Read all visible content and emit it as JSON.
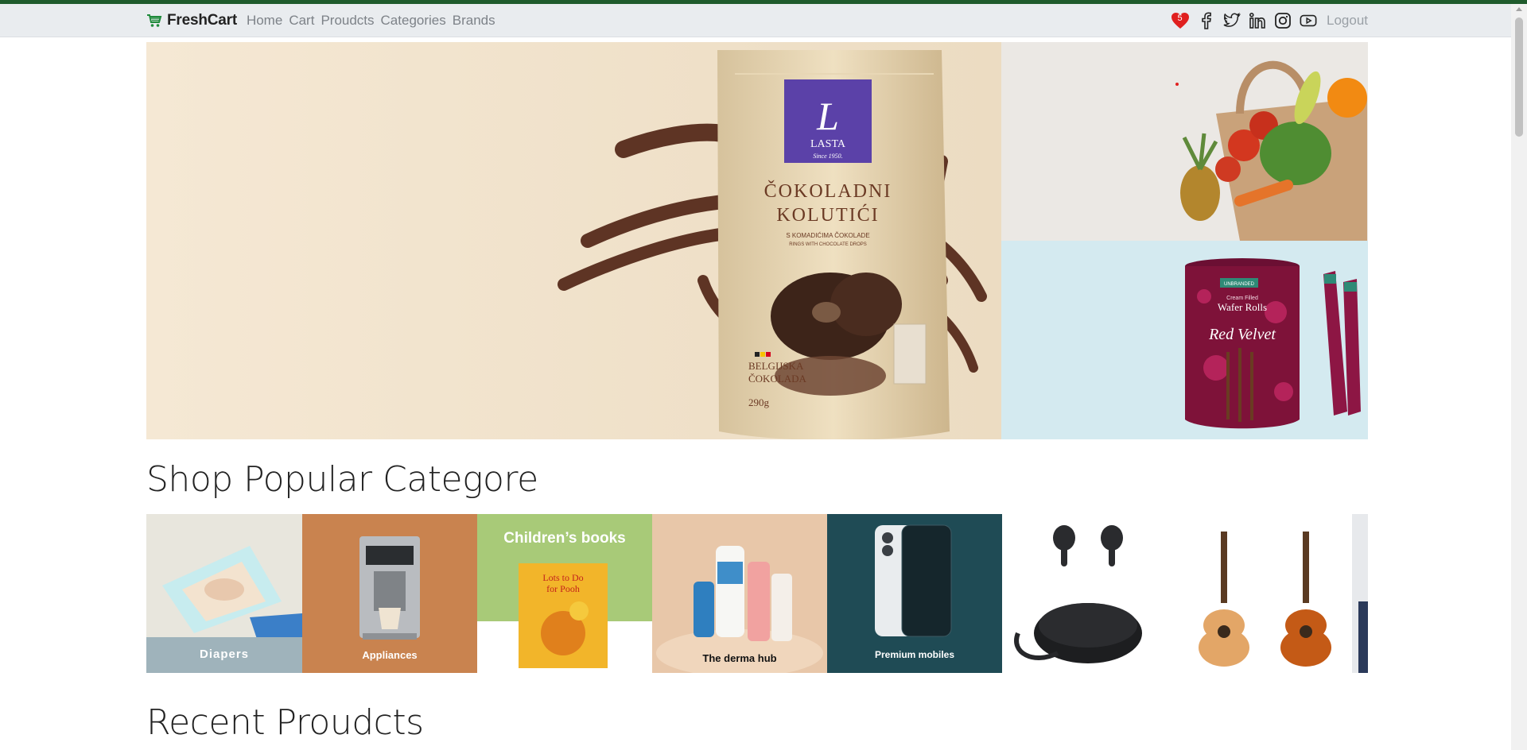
{
  "brand": {
    "name": "FreshCart",
    "icon": "cart-icon"
  },
  "nav": {
    "links": [
      "Home",
      "Cart",
      "Proudcts",
      "Categories",
      "Brands"
    ],
    "wishlist_count": "5",
    "social": [
      "facebook-icon",
      "twitter-icon",
      "linkedin-icon",
      "instagram-icon",
      "youtube-icon"
    ],
    "logout": "Logout"
  },
  "hero": {
    "main": {
      "brand": "LASTA",
      "since": "Since 1950.",
      "product_line1": "ČOKOLADNI",
      "product_line2": "KOLUTIĆI",
      "sub1": "S KOMADIĆIMA ČOKOLADE",
      "sub2": "RINGS WITH CHOCOLATE DROPS",
      "origin1": "BELGIJSKA",
      "origin2": "ČOKOLADA",
      "weight": "290g"
    },
    "bottom_right": {
      "brand": "UNBRANDED",
      "line1": "Cream Filled",
      "line2": "Wafer Rolls",
      "line3": "Red Velvet"
    }
  },
  "sections": {
    "popular_title": "Shop Popular Categore",
    "recent_title": "Recent Proudcts"
  },
  "categories": [
    {
      "label": "Diapers"
    },
    {
      "label": "Appliances"
    },
    {
      "label": "Children’s books",
      "book_title": "Lots to Do for Pooh"
    },
    {
      "label": "The derma hub"
    },
    {
      "label": "Premium mobiles"
    },
    {
      "label": ""
    },
    {
      "label": ""
    },
    {
      "label": ""
    }
  ],
  "colors": {
    "accent": "#1f5b2c",
    "navbar_bg": "#e9ecef",
    "badge": "#e0201f",
    "hero_main_bg": "#f3e5cf",
    "hero_br_bg": "#d4eaf0"
  }
}
